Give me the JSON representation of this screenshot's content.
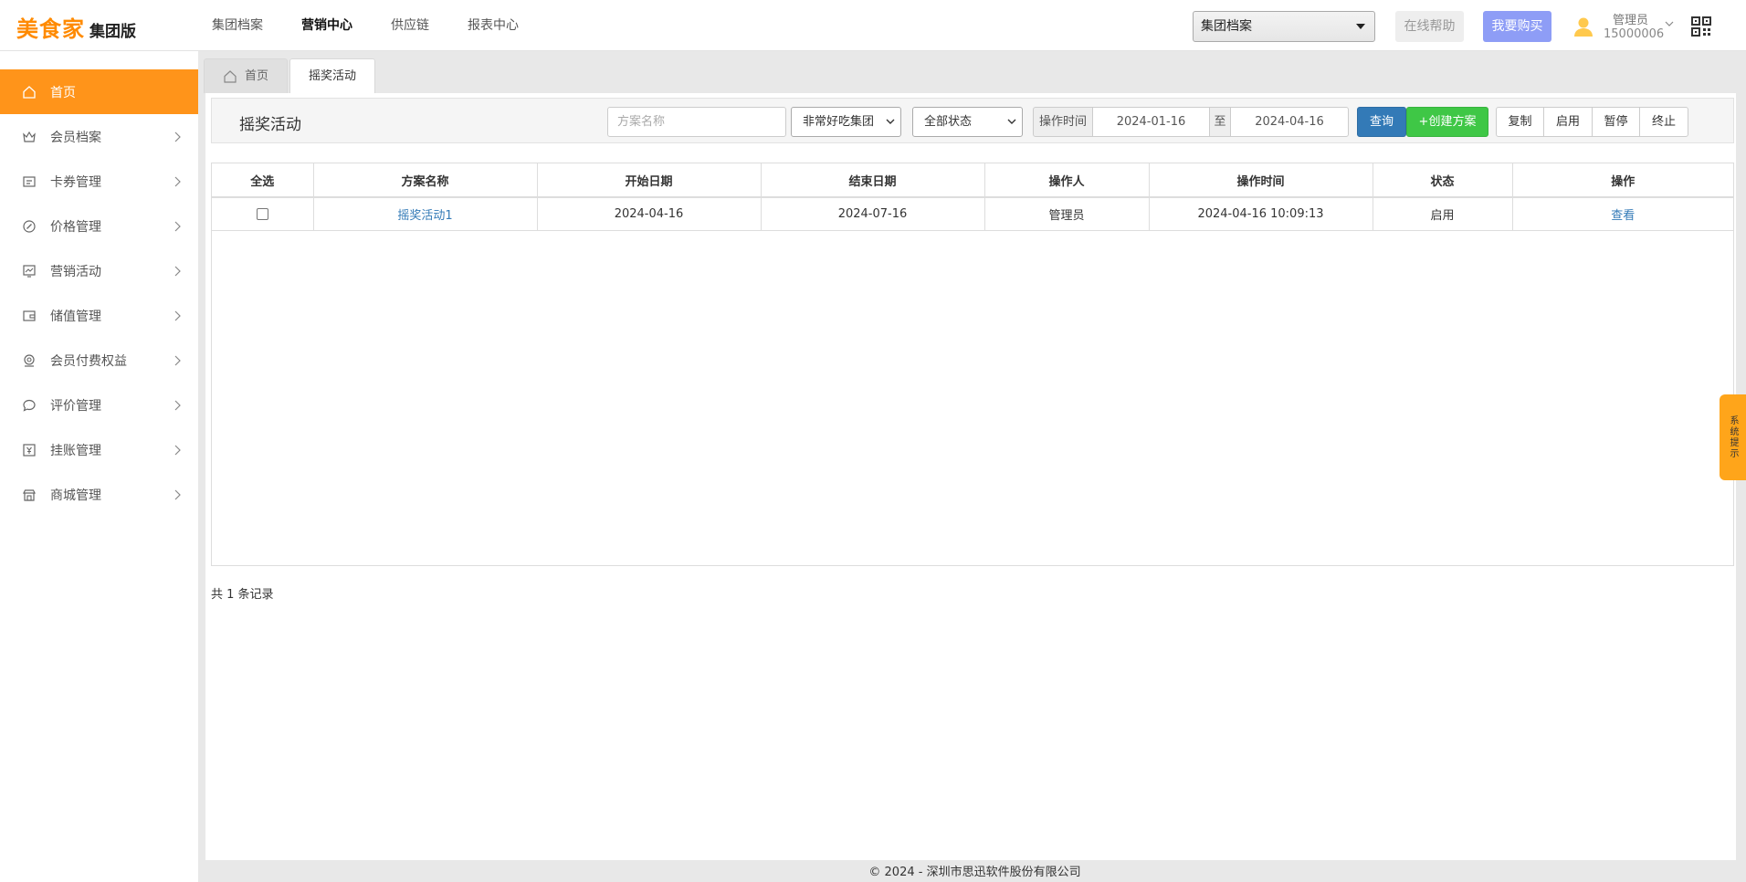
{
  "header": {
    "brand": "美食家",
    "edition": "集团版",
    "nav": [
      {
        "label": "集团档案",
        "active": false
      },
      {
        "label": "营销中心",
        "active": true
      },
      {
        "label": "供应链",
        "active": false
      },
      {
        "label": "报表中心",
        "active": false
      }
    ],
    "group_select": "集团档案",
    "help_label": "在线帮助",
    "buy_label": "我要购买",
    "user_role": "管理员",
    "user_id": "15000006",
    "accent_color": "#ff941a"
  },
  "sidebar": {
    "items": [
      {
        "label": "首页",
        "icon": "home-icon",
        "active": true
      },
      {
        "label": "会员档案",
        "icon": "crown-icon"
      },
      {
        "label": "卡券管理",
        "icon": "card-icon"
      },
      {
        "label": "价格管理",
        "icon": "price-icon"
      },
      {
        "label": "营销活动",
        "icon": "chart-icon"
      },
      {
        "label": "储值管理",
        "icon": "wallet-icon"
      },
      {
        "label": "会员付费权益",
        "icon": "badge-icon"
      },
      {
        "label": "评价管理",
        "icon": "comment-icon"
      },
      {
        "label": "挂账管理",
        "icon": "bill-icon"
      },
      {
        "label": "商城管理",
        "icon": "shop-icon"
      }
    ]
  },
  "tabs": [
    {
      "label": "首页",
      "icon": "home-icon",
      "active": false
    },
    {
      "label": "摇奖活动",
      "active": true
    }
  ],
  "toolbar": {
    "title": "摇奖活动",
    "name_placeholder": "方案名称",
    "org_select": "非常好吃集团",
    "status_select": "全部状态",
    "time_label": "操作时间",
    "date_from": "2024-01-16",
    "date_sep": "至",
    "date_to": "2024-04-16",
    "query_label": "查询",
    "create_label": "+创建方案",
    "copy_label": "复制",
    "enable_label": "启用",
    "pause_label": "暂停",
    "stop_label": "终止"
  },
  "table": {
    "headers": [
      "全选",
      "方案名称",
      "开始日期",
      "结束日期",
      "操作人",
      "操作时间",
      "状态",
      "操作"
    ],
    "rows": [
      {
        "name": "摇奖活动1",
        "start": "2024-04-16",
        "end": "2024-07-16",
        "operator": "管理员",
        "op_time": "2024-04-16 10:09:13",
        "status": "启用",
        "action": "查看"
      }
    ]
  },
  "records_text": "共 1 条记录",
  "footer": "© 2024 - 深圳市思迅软件股份有限公司",
  "system_tip": "系统提示"
}
